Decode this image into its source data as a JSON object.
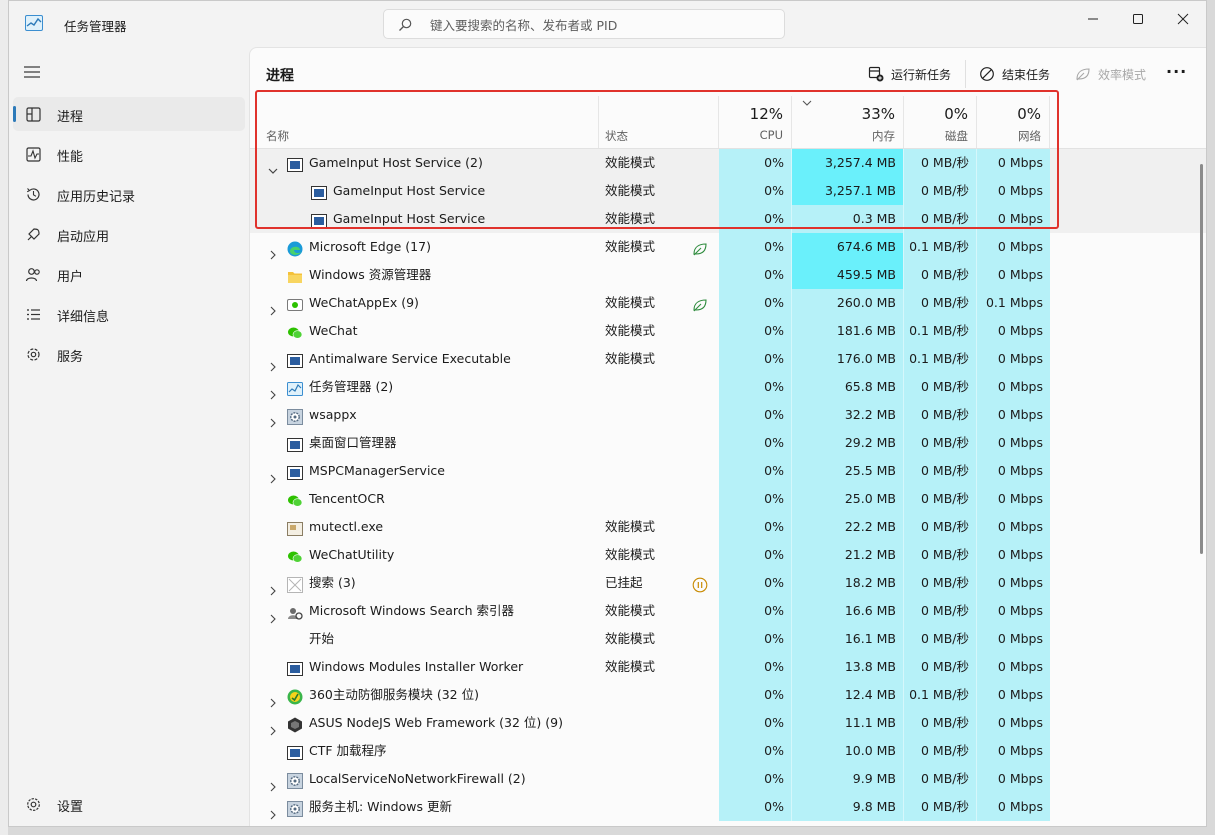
{
  "window": {
    "title": "任务管理器",
    "search_placeholder": "键入要搜索的名称、发布者或 PID"
  },
  "sidebar": {
    "items": [
      {
        "label": "进程",
        "icon": "processes-icon",
        "active": true
      },
      {
        "label": "性能",
        "icon": "performance-icon"
      },
      {
        "label": "应用历史记录",
        "icon": "app-history-icon"
      },
      {
        "label": "启动应用",
        "icon": "startup-icon"
      },
      {
        "label": "用户",
        "icon": "users-icon"
      },
      {
        "label": "详细信息",
        "icon": "details-icon"
      },
      {
        "label": "服务",
        "icon": "services-icon"
      }
    ],
    "settings_label": "设置"
  },
  "toolbar": {
    "page_title": "进程",
    "run_new_task": "运行新任务",
    "end_task": "结束任务",
    "efficiency_mode": "效率模式",
    "more": "···"
  },
  "columns": {
    "name": "名称",
    "status": "状态",
    "cpu_pct": "12%",
    "cpu": "CPU",
    "mem_pct": "33%",
    "mem": "内存",
    "disk_pct": "0%",
    "disk": "磁盘",
    "net_pct": "0%",
    "net": "网络"
  },
  "colors": {
    "heat_low": "#b6f1f8",
    "heat_high": "#6af0fb",
    "highlight_border": "#e0322c",
    "accent": "#2d7ab9"
  },
  "rows": [
    {
      "name": "GameInput Host Service (2)",
      "status": "效能模式",
      "cpu": "0%",
      "mem": "3,257.4 MB",
      "disk": "0 MB/秒",
      "net": "0 Mbps",
      "icon": "service-window-icon",
      "expand": "open",
      "level": 0,
      "mem_heat": "high"
    },
    {
      "name": "GameInput Host Service",
      "status": "效能模式",
      "cpu": "0%",
      "mem": "3,257.1 MB",
      "disk": "0 MB/秒",
      "net": "0 Mbps",
      "icon": "service-window-icon",
      "expand": "none",
      "level": 1,
      "mem_heat": "high"
    },
    {
      "name": "GameInput Host Service",
      "status": "效能模式",
      "cpu": "0%",
      "mem": "0.3 MB",
      "disk": "0 MB/秒",
      "net": "0 Mbps",
      "icon": "service-window-icon",
      "expand": "none",
      "level": 1,
      "mem_heat": "low"
    },
    {
      "name": "Microsoft Edge (17)",
      "status": "效能模式",
      "cpu": "0%",
      "mem": "674.6 MB",
      "disk": "0.1 MB/秒",
      "net": "0 Mbps",
      "icon": "edge-icon",
      "expand": "closed",
      "level": 0,
      "mem_heat": "high",
      "leaf": true
    },
    {
      "name": "Windows 资源管理器",
      "status": "",
      "cpu": "0%",
      "mem": "459.5 MB",
      "disk": "0 MB/秒",
      "net": "0 Mbps",
      "icon": "folder-icon",
      "expand": "none",
      "level": 0,
      "mem_heat": "high"
    },
    {
      "name": "WeChatAppEx (9)",
      "status": "效能模式",
      "cpu": "0%",
      "mem": "260.0 MB",
      "disk": "0 MB/秒",
      "net": "0.1 Mbps",
      "icon": "wechat-appex-icon",
      "expand": "closed",
      "level": 0,
      "mem_heat": "low",
      "leaf": true
    },
    {
      "name": "WeChat",
      "status": "效能模式",
      "cpu": "0%",
      "mem": "181.6 MB",
      "disk": "0.1 MB/秒",
      "net": "0 Mbps",
      "icon": "wechat-icon",
      "expand": "none",
      "level": 0,
      "mem_heat": "low"
    },
    {
      "name": "Antimalware Service Executable",
      "status": "效能模式",
      "cpu": "0%",
      "mem": "176.0 MB",
      "disk": "0.1 MB/秒",
      "net": "0 Mbps",
      "icon": "service-window-icon",
      "expand": "closed",
      "level": 0,
      "mem_heat": "low"
    },
    {
      "name": "任务管理器 (2)",
      "status": "",
      "cpu": "0%",
      "mem": "65.8 MB",
      "disk": "0 MB/秒",
      "net": "0 Mbps",
      "icon": "task-manager-icon",
      "expand": "closed",
      "level": 0,
      "mem_heat": "low"
    },
    {
      "name": "wsappx",
      "status": "",
      "cpu": "0%",
      "mem": "32.2 MB",
      "disk": "0 MB/秒",
      "net": "0 Mbps",
      "icon": "gear-icon",
      "expand": "closed",
      "level": 0,
      "mem_heat": "low"
    },
    {
      "name": "桌面窗口管理器",
      "status": "",
      "cpu": "0%",
      "mem": "29.2 MB",
      "disk": "0 MB/秒",
      "net": "0 Mbps",
      "icon": "service-window-icon",
      "expand": "none",
      "level": 0,
      "mem_heat": "low"
    },
    {
      "name": "MSPCManagerService",
      "status": "",
      "cpu": "0%",
      "mem": "25.5 MB",
      "disk": "0 MB/秒",
      "net": "0 Mbps",
      "icon": "service-window-icon",
      "expand": "closed",
      "level": 0,
      "mem_heat": "low"
    },
    {
      "name": "TencentOCR",
      "status": "",
      "cpu": "0%",
      "mem": "25.0 MB",
      "disk": "0 MB/秒",
      "net": "0 Mbps",
      "icon": "wechat-icon",
      "expand": "none",
      "level": 0,
      "mem_heat": "low"
    },
    {
      "name": "mutectl.exe",
      "status": "效能模式",
      "cpu": "0%",
      "mem": "22.2 MB",
      "disk": "0 MB/秒",
      "net": "0 Mbps",
      "icon": "mutectl-icon",
      "expand": "none",
      "level": 0,
      "mem_heat": "low"
    },
    {
      "name": "WeChatUtility",
      "status": "效能模式",
      "cpu": "0%",
      "mem": "21.2 MB",
      "disk": "0 MB/秒",
      "net": "0 Mbps",
      "icon": "wechat-icon",
      "expand": "none",
      "level": 0,
      "mem_heat": "low"
    },
    {
      "name": "搜索 (3)",
      "status": "已挂起",
      "cpu": "0%",
      "mem": "18.2 MB",
      "disk": "0 MB/秒",
      "net": "0 Mbps",
      "icon": "search-app-icon",
      "expand": "closed",
      "level": 0,
      "mem_heat": "low",
      "paused": true
    },
    {
      "name": "Microsoft Windows Search 索引器",
      "status": "效能模式",
      "cpu": "0%",
      "mem": "16.6 MB",
      "disk": "0 MB/秒",
      "net": "0 Mbps",
      "icon": "search-indexer-icon",
      "expand": "closed",
      "level": 0,
      "mem_heat": "low"
    },
    {
      "name": "开始",
      "status": "效能模式",
      "cpu": "0%",
      "mem": "16.1 MB",
      "disk": "0 MB/秒",
      "net": "0 Mbps",
      "icon": "",
      "expand": "none",
      "level": 0,
      "mem_heat": "low"
    },
    {
      "name": "Windows Modules Installer Worker",
      "status": "效能模式",
      "cpu": "0%",
      "mem": "13.8 MB",
      "disk": "0 MB/秒",
      "net": "0 Mbps",
      "icon": "service-window-icon",
      "expand": "none",
      "level": 0,
      "mem_heat": "low"
    },
    {
      "name": "360主动防御服务模块 (32 位)",
      "status": "",
      "cpu": "0%",
      "mem": "12.4 MB",
      "disk": "0.1 MB/秒",
      "net": "0 Mbps",
      "icon": "360-icon",
      "expand": "closed",
      "level": 0,
      "mem_heat": "low"
    },
    {
      "name": "ASUS NodeJS Web Framework (32 位) (9)",
      "status": "",
      "cpu": "0%",
      "mem": "11.1 MB",
      "disk": "0 MB/秒",
      "net": "0 Mbps",
      "icon": "nodejs-icon",
      "expand": "closed",
      "level": 0,
      "mem_heat": "low"
    },
    {
      "name": "CTF 加载程序",
      "status": "",
      "cpu": "0%",
      "mem": "10.0 MB",
      "disk": "0 MB/秒",
      "net": "0 Mbps",
      "icon": "service-window-icon",
      "expand": "none",
      "level": 0,
      "mem_heat": "low"
    },
    {
      "name": "LocalServiceNoNetworkFirewall (2)",
      "status": "",
      "cpu": "0%",
      "mem": "9.9 MB",
      "disk": "0 MB/秒",
      "net": "0 Mbps",
      "icon": "gear-icon",
      "expand": "closed",
      "level": 0,
      "mem_heat": "low"
    },
    {
      "name": "服务主机: Windows 更新",
      "status": "",
      "cpu": "0%",
      "mem": "9.8 MB",
      "disk": "0 MB/秒",
      "net": "0 Mbps",
      "icon": "gear-icon",
      "expand": "closed",
      "level": 0,
      "mem_heat": "low"
    }
  ]
}
